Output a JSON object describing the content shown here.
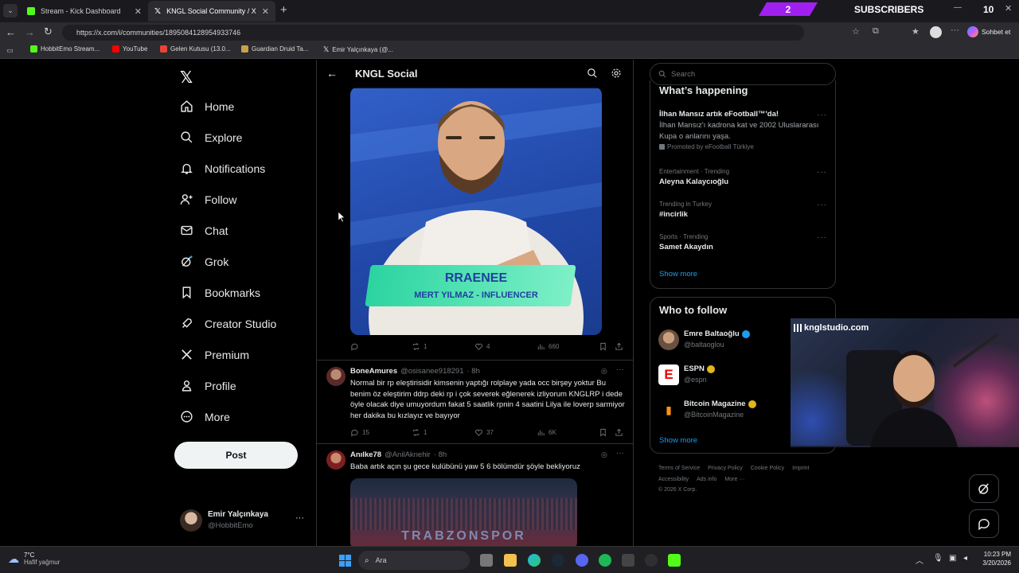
{
  "browser": {
    "tabs": [
      {
        "label": "Stream - Kick Dashboard",
        "icon": "kick-icon",
        "active": false
      },
      {
        "label": "KNGL Social Community / X",
        "icon": "x-logo-icon",
        "active": true
      }
    ],
    "url": "https://x.com/i/communities/1895084128954933746",
    "profile_button": "Sohbet et",
    "bookmarks": [
      {
        "label": "HobbitEmo Stream...",
        "icon": "kick-icon",
        "color": "#53fc18"
      },
      {
        "label": "YouTube",
        "icon": "youtube-icon",
        "color": "#ff0000"
      },
      {
        "label": "Gelen Kutusu (13.0...",
        "icon": "gmail-icon",
        "color": "#ea4335"
      },
      {
        "label": "Guardian Druid Ta...",
        "icon": "wow-icon",
        "color": "#c9a14a"
      },
      {
        "label": "Emir Yalçınkaya (@...",
        "icon": "x-logo-icon",
        "color": "#ffffff"
      }
    ]
  },
  "overlay": {
    "subscriber_count": "2",
    "subscribers_label": "SUBSCRIBERS",
    "corner_number": "10",
    "webcam_label": "knglstudio.com"
  },
  "sidebar": {
    "items": [
      {
        "label": "Home",
        "icon": "home-icon"
      },
      {
        "label": "Explore",
        "icon": "search-icon"
      },
      {
        "label": "Notifications",
        "icon": "bell-icon"
      },
      {
        "label": "Follow",
        "icon": "person-add-icon"
      },
      {
        "label": "Chat",
        "icon": "mail-icon"
      },
      {
        "label": "Grok",
        "icon": "grok-icon"
      },
      {
        "label": "Bookmarks",
        "icon": "bookmark-icon"
      },
      {
        "label": "Creator Studio",
        "icon": "rocket-icon"
      },
      {
        "label": "Premium",
        "icon": "x-logo-icon"
      },
      {
        "label": "Profile",
        "icon": "person-icon"
      },
      {
        "label": "More",
        "icon": "more-circle-icon"
      }
    ],
    "post_button": "Post",
    "account": {
      "name": "Emir Yalçınkaya",
      "handle": "@HobbitEmo"
    }
  },
  "column": {
    "title": "KNGL Social",
    "first_post": {
      "image_text_name": "RRAENEE",
      "image_text_sub": "MERT YILMAZ - INFLUENCER",
      "replies": "",
      "reposts": "1",
      "likes": "4",
      "views": "660"
    },
    "posts": [
      {
        "name": "BoneAmures",
        "handle": "@osisanee918291",
        "time": "· 8h",
        "text": "Normal bir rp eleştirisidir kimsenin yaptığı rolplaye yada occ birşey yoktur Bu benim öz eleştirim ddrp deki rp i çok severek eğlenerek izliyorum KNGLRP i dede öyle olacak diye umuyordum fakat 5 saatlik rpnin 4 saatini Lilya ile loverp sarmiyor her dakika bu kızlayız ve bayıyor",
        "replies": "15",
        "reposts": "1",
        "likes": "37",
        "views": "6K"
      },
      {
        "name": "Anılke78",
        "handle": "@AnilAknehir",
        "time": "· 8h",
        "text": "Baba artık açın şu gece kulübünü yaw 5 6 bölümdür şöyle bekliyoruz",
        "image_caption": "TRABZONSPOR"
      }
    ]
  },
  "right": {
    "search_placeholder": "Search",
    "happening_title": "What’s happening",
    "promo": {
      "title": "İlhan Mansız artık eFootball™'da!",
      "body": "İlhan Mansız'ı kadrona kat ve 2002 Uluslararası Kupa o anlarını yaşa.",
      "promoted": "Promoted by eFootball Türkiye"
    },
    "trends": [
      {
        "meta": "Entertainment · Trending",
        "name": "Aleyna Kalaycıoğlu"
      },
      {
        "meta": "Trending in Turkey",
        "name": "#incirlik"
      },
      {
        "meta": "Sports · Trending",
        "name": "Samet Akaydın"
      }
    ],
    "show_more": "Show more",
    "who_to_follow_title": "Who to follow",
    "follow": [
      {
        "name": "Emre Baltaoğlu",
        "handle": "@baltaoglou",
        "badge_color": "#1d9bf0"
      },
      {
        "name": "ESPN",
        "handle": "@espn",
        "badge_color": "#e2b719"
      },
      {
        "name": "Bitcoin Magazine",
        "handle": "@BitcoinMagazine",
        "badge_color": "#e2b719"
      }
    ],
    "show_more_2": "Show more",
    "footer": [
      "Terms of Service",
      "Privacy Policy",
      "Cookie Policy",
      "Imprint",
      "Accessibility",
      "Ads info",
      "More ···",
      "© 2026 X Corp."
    ]
  },
  "taskbar": {
    "weather_temp": "7°C",
    "weather_desc": "Hafif yağmur",
    "search_label": "Ara",
    "time": "10:23 PM",
    "date": "3/20/2026"
  },
  "colors": {
    "accent": "#1d9bf0",
    "overlay_purple": "#a020f0"
  }
}
